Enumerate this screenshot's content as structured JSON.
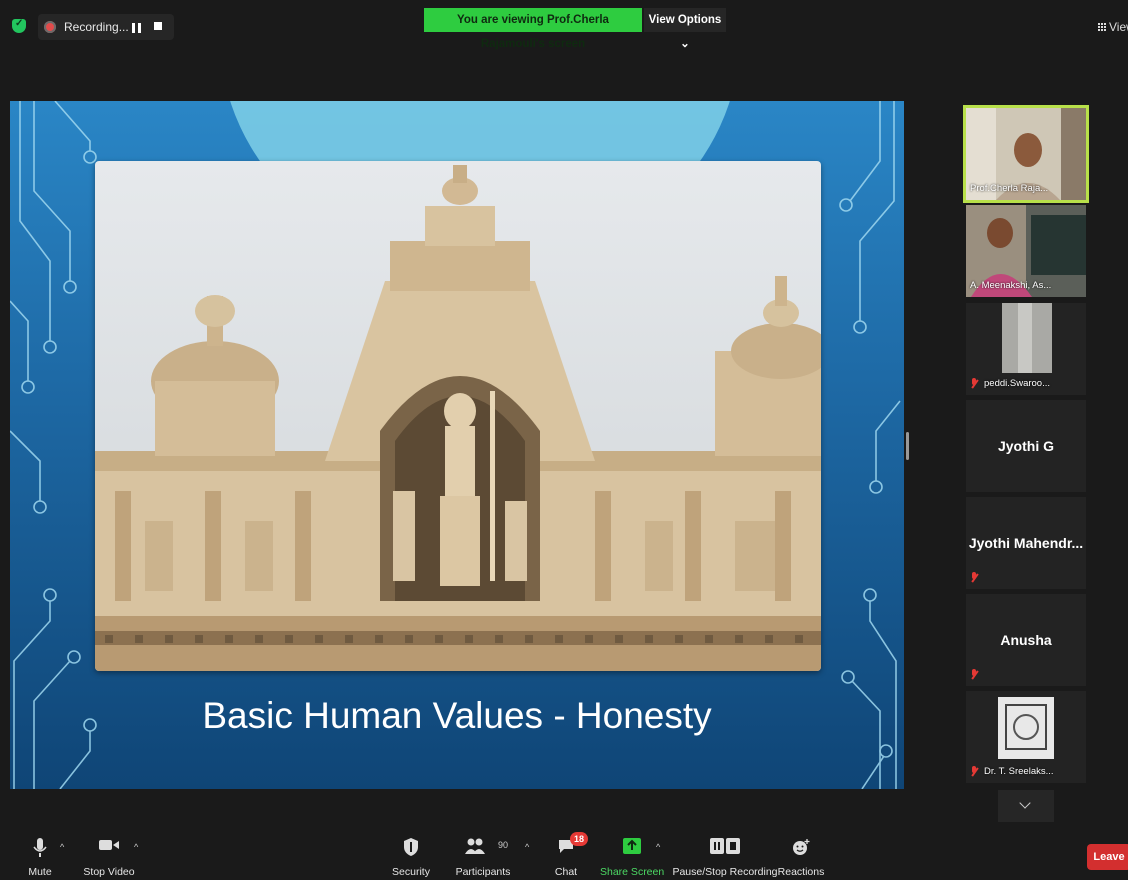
{
  "topbar": {
    "recording_label": "Recording...",
    "viewing_banner": "You are viewing Prof.Cherla Rajamouli's screen",
    "view_options": "View Options ⌄",
    "view_right": "View"
  },
  "slide": {
    "title": "Basic Human Values - Honesty"
  },
  "participants": [
    {
      "name": "Prof.Cherla Raja...",
      "video": true,
      "active": true
    },
    {
      "name": "A. Meenakshi, As...",
      "video": true,
      "active": false
    },
    {
      "name": "peddi.Swaroo...",
      "video": true,
      "muted": true
    },
    {
      "name": "Jyothi G",
      "video": false
    },
    {
      "name": "Jyothi  Mahendr...",
      "video": false,
      "muted": true
    },
    {
      "name": "Anusha",
      "video": false,
      "muted": true
    },
    {
      "name": "Dr. T. Sreelaks...",
      "video": true,
      "muted": true
    }
  ],
  "toolbar": {
    "mute": "Mute",
    "stop_video": "Stop Video",
    "security": "Security",
    "participants": "Participants",
    "participants_count": "90",
    "chat": "Chat",
    "chat_badge": "18",
    "share_screen": "Share Screen",
    "pause_stop_recording": "Pause/Stop Recording",
    "reactions": "Reactions",
    "leave": "Leave"
  },
  "colors": {
    "share_green": "#2ecc40",
    "active_border": "#b8e04a",
    "leave_red": "#d32f2f",
    "slide_blue": "#1e6aa6"
  }
}
